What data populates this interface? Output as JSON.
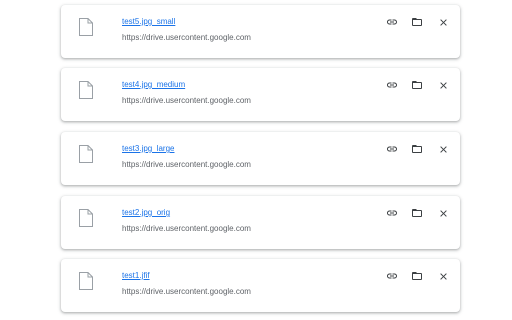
{
  "downloads": [
    {
      "file_name": "test5.jpg_small",
      "url": "https://drive.usercontent.google.com"
    },
    {
      "file_name": "test4.jpg_medium",
      "url": "https://drive.usercontent.google.com"
    },
    {
      "file_name": "test3.jpg_large",
      "url": "https://drive.usercontent.google.com"
    },
    {
      "file_name": "test2.jpg_orig",
      "url": "https://drive.usercontent.google.com"
    },
    {
      "file_name": "test1.jfif",
      "url": "https://drive.usercontent.google.com"
    }
  ],
  "icons": {
    "file": "file-icon",
    "copy_link": "link-icon",
    "show_in_folder": "folder-icon",
    "remove": "close-icon"
  },
  "colors": {
    "link": "#1a73e8",
    "secondary_text": "#5f6368",
    "icon": "#3c4043"
  }
}
